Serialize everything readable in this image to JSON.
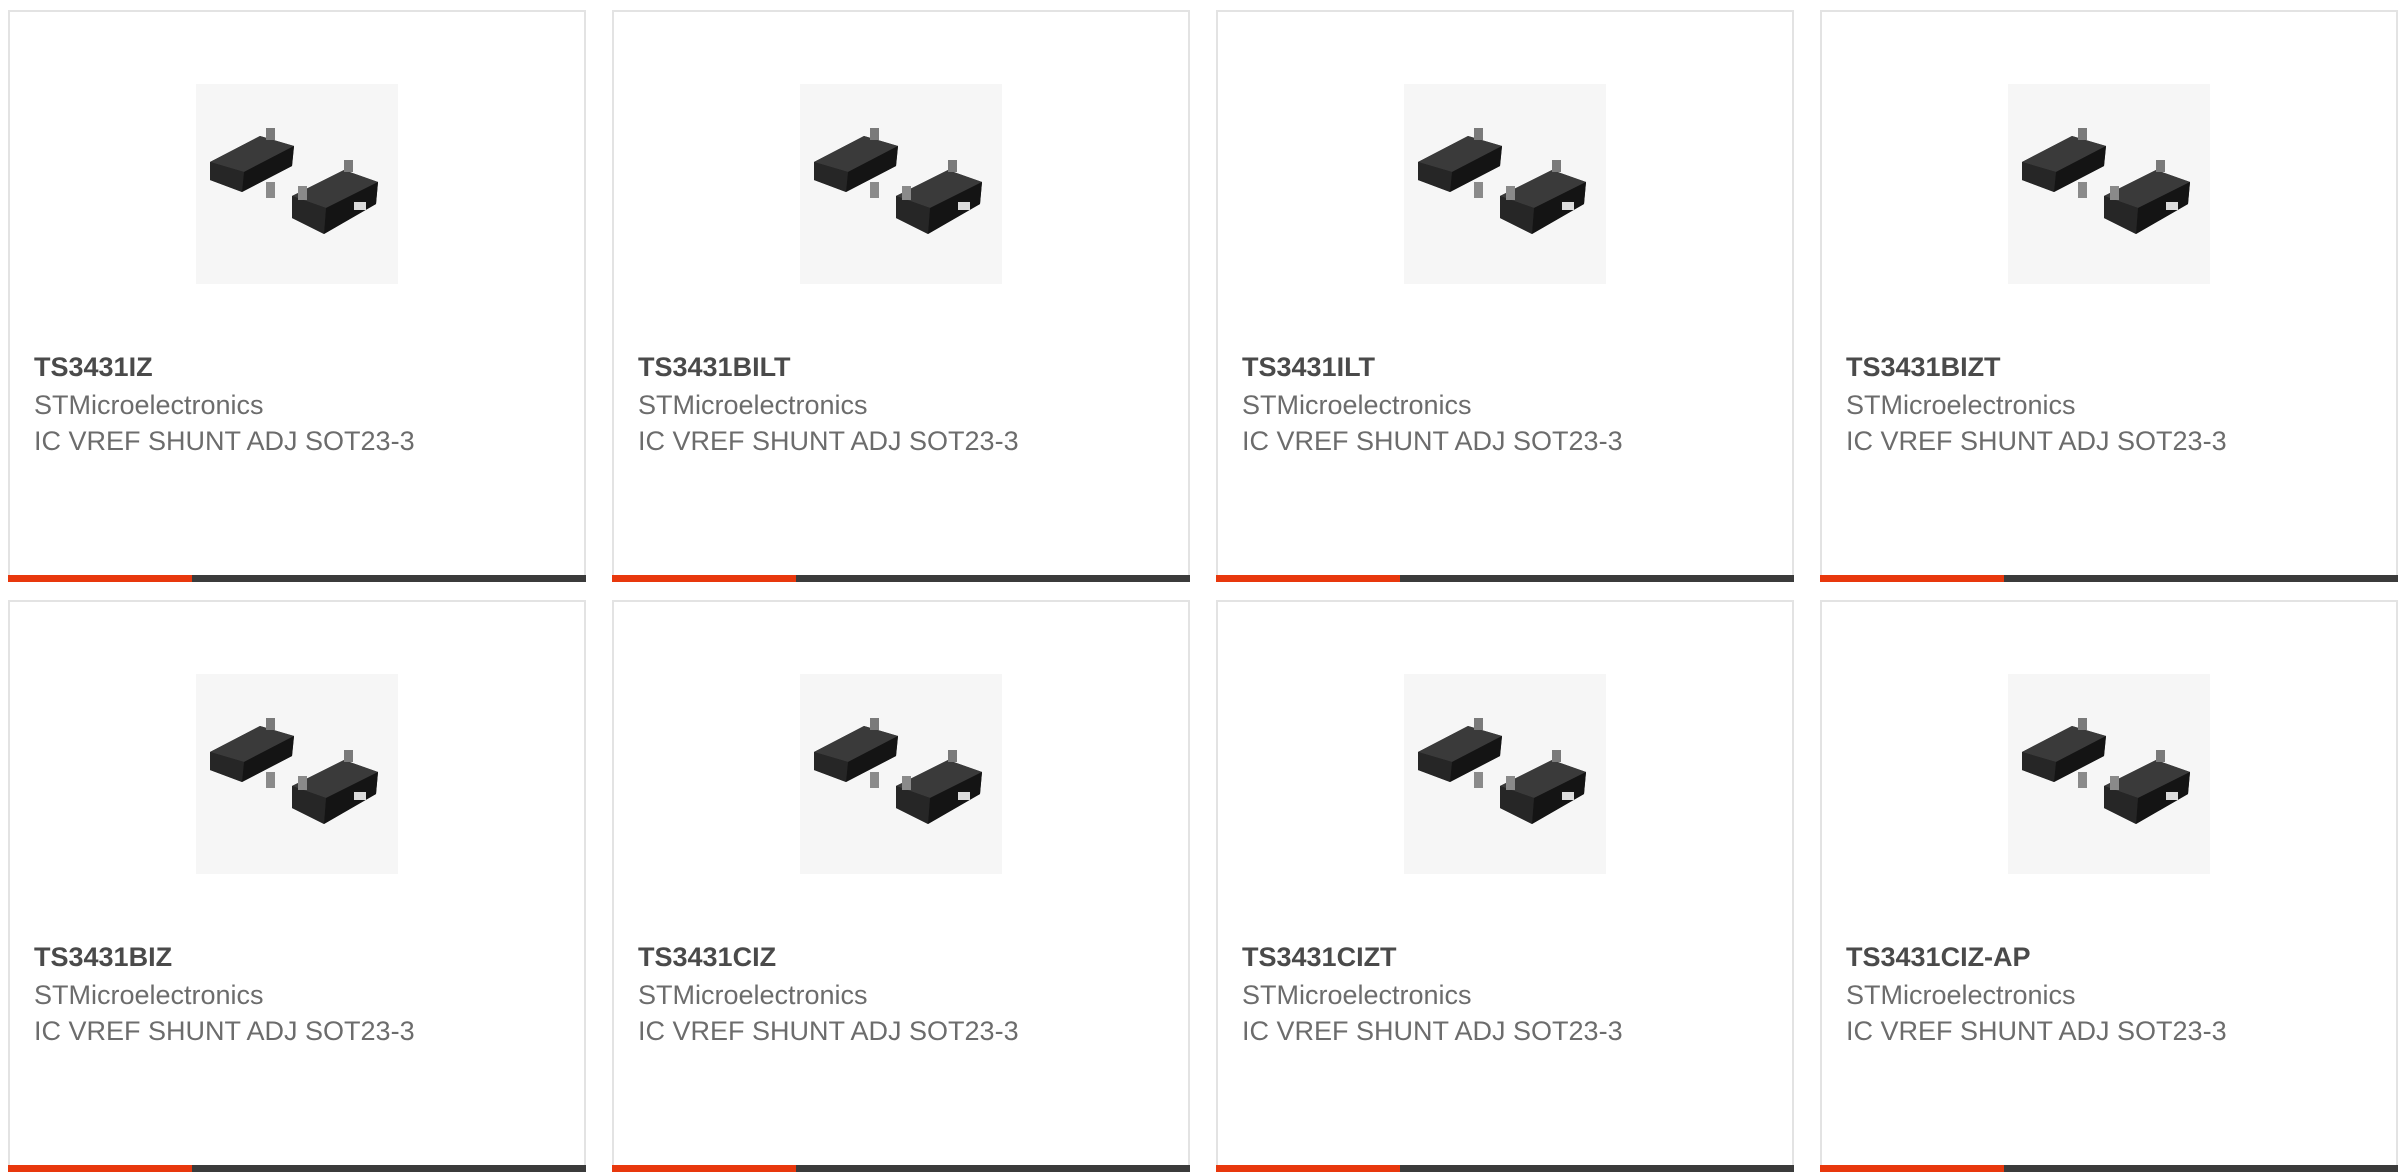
{
  "accent_color": "#e8380d",
  "products": [
    {
      "part": "TS3431IZ",
      "manufacturer": "STMicroelectronics",
      "description": "IC VREF SHUNT ADJ SOT23-3",
      "image": "sot23-3-package-image"
    },
    {
      "part": "TS3431BILT",
      "manufacturer": "STMicroelectronics",
      "description": "IC VREF SHUNT ADJ SOT23-3",
      "image": "sot23-3-package-image"
    },
    {
      "part": "TS3431ILT",
      "manufacturer": "STMicroelectronics",
      "description": "IC VREF SHUNT ADJ SOT23-3",
      "image": "sot23-3-package-image"
    },
    {
      "part": "TS3431BIZT",
      "manufacturer": "STMicroelectronics",
      "description": "IC VREF SHUNT ADJ SOT23-3",
      "image": "sot23-3-package-image"
    },
    {
      "part": "TS3431BIZ",
      "manufacturer": "STMicroelectronics",
      "description": "IC VREF SHUNT ADJ SOT23-3",
      "image": "sot23-3-package-image"
    },
    {
      "part": "TS3431CIZ",
      "manufacturer": "STMicroelectronics",
      "description": "IC VREF SHUNT ADJ SOT23-3",
      "image": "sot23-3-package-image"
    },
    {
      "part": "TS3431CIZT",
      "manufacturer": "STMicroelectronics",
      "description": "IC VREF SHUNT ADJ SOT23-3",
      "image": "sot23-3-package-image"
    },
    {
      "part": "TS3431CIZ-AP",
      "manufacturer": "STMicroelectronics",
      "description": "IC VREF SHUNT ADJ SOT23-3",
      "image": "sot23-3-package-image"
    }
  ]
}
